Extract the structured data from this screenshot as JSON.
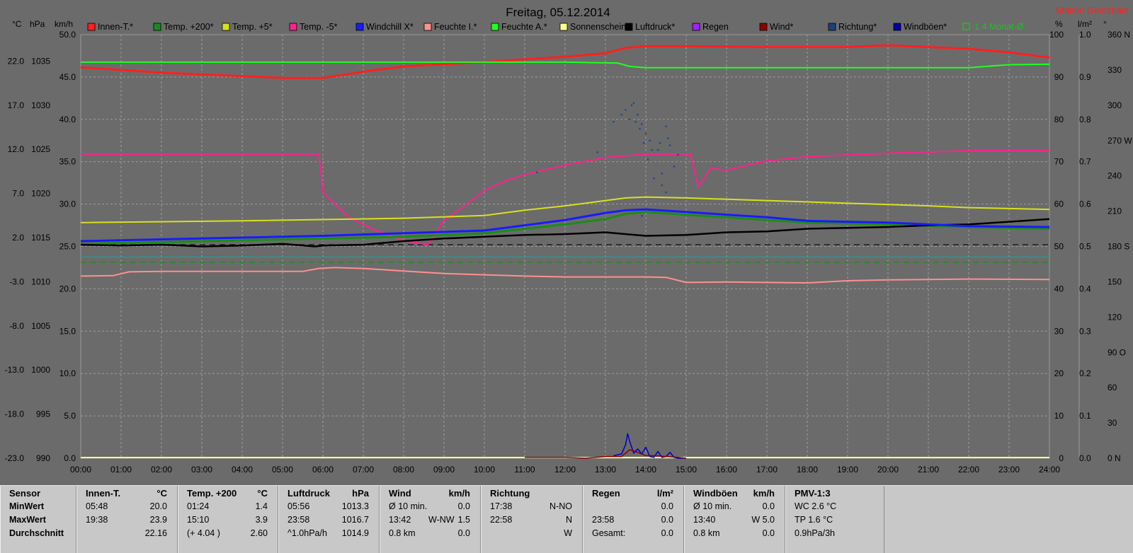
{
  "chart_data": {
    "type": "line",
    "title": "Freitag, 05.12.2014",
    "station": "Station Göritzhain",
    "axis_units": {
      "c": "°C",
      "hpa": "hPa",
      "kmh": "km/h",
      "pct": "%",
      "lm2": "l/m²",
      "deg": "°"
    },
    "x_ticks": [
      "00:00",
      "01:00",
      "02:00",
      "03:00",
      "04:00",
      "05:00",
      "06:00",
      "07:00",
      "08:00",
      "09:00",
      "10:00",
      "11:00",
      "12:00",
      "13:00",
      "14:00",
      "15:00",
      "16:00",
      "17:00",
      "18:00",
      "19:00",
      "20:00",
      "21:00",
      "22:00",
      "23:00",
      "24:00"
    ],
    "xlim": [
      0,
      24
    ],
    "left_axes": {
      "c": [
        "22.0",
        "17.0",
        "12.0",
        "7.0",
        "2.0",
        "-3.0",
        "-8.0",
        "-13.0",
        "-18.0",
        "-23.0"
      ],
      "hpa": [
        "1035",
        "1030",
        "1025",
        "1020",
        "1015",
        "1010",
        "1005",
        "1000",
        "995",
        "990"
      ],
      "kmh": [
        "50.0",
        "45.0",
        "40.0",
        "35.0",
        "30.0",
        "25.0",
        "20.0",
        "15.0",
        "10.0",
        "5.0",
        "0.0"
      ]
    },
    "right_axes": {
      "pct": [
        "100",
        "90",
        "80",
        "70",
        "60",
        "50",
        "40",
        "30",
        "20",
        "10",
        "0"
      ],
      "lm2": [
        "1.0",
        "0.9",
        "0.8",
        "0.7",
        "0.6",
        "0.5",
        "0.4",
        "0.3",
        "0.2",
        "0.1",
        "0.0"
      ],
      "deg": [
        "360 N",
        "330",
        "300",
        "270 W",
        "240",
        "210",
        "180 S",
        "150",
        "120",
        "90 O",
        "60",
        "30",
        "0 N"
      ]
    },
    "legend": [
      {
        "name": "Innen-T.*",
        "color": "#ff2020"
      },
      {
        "name": "Temp. +200*",
        "color": "#1a8c1a"
      },
      {
        "name": "Temp. +5*",
        "color": "#d8e020"
      },
      {
        "name": "Temp. -5*",
        "color": "#ff2090"
      },
      {
        "name": "Windchill X*",
        "color": "#1a1aff"
      },
      {
        "name": "Feuchte I.*",
        "color": "#ff9090"
      },
      {
        "name": "Feuchte A.*",
        "color": "#20ff20"
      },
      {
        "name": "Sonnenschein",
        "color": "#ffff90"
      },
      {
        "name": "Luftdruck*",
        "color": "#000000"
      },
      {
        "name": "Regen",
        "color": "#a020ff"
      },
      {
        "name": "Wind*",
        "color": "#8c0000"
      },
      {
        "name": "Richtung*",
        "color": "#1a4080"
      },
      {
        "name": "Windböen*",
        "color": "#0000a0"
      },
      {
        "name": "-1.4 Monat-Ø",
        "color": "#20c020"
      }
    ],
    "series": [
      {
        "name": "Innen-T.*",
        "axis": "c",
        "color": "#ff2020",
        "width": 3,
        "x": [
          0,
          2,
          4,
          5,
          6,
          7,
          8,
          10,
          12,
          13,
          13.5,
          14,
          15,
          17,
          19,
          20,
          22,
          23,
          24
        ],
        "y": [
          21.3,
          20.7,
          20.3,
          20.1,
          20.1,
          20.8,
          21.4,
          21.9,
          22.5,
          22.9,
          23.5,
          23.7,
          23.7,
          23.6,
          23.6,
          23.8,
          23.4,
          23.0,
          22.4
        ]
      },
      {
        "name": "Feuchte A.*",
        "axis": "pct",
        "color": "#20ff20",
        "width": 2,
        "x": [
          0,
          6,
          12,
          13.3,
          13.6,
          14,
          18,
          22,
          23,
          24
        ],
        "y": [
          93.5,
          93.5,
          93.5,
          93.3,
          92.5,
          92.2,
          92.2,
          92.2,
          92.9,
          93.0
        ]
      },
      {
        "name": "Temp. -5*",
        "axis": "kmh",
        "color": "#ff2090",
        "width": 2,
        "x": [
          0,
          2,
          4,
          5.5,
          5.9,
          6.0,
          6.6,
          7.2,
          8,
          8.6,
          9.0,
          9.4,
          10,
          10.5,
          11,
          12,
          13,
          14,
          14.5,
          15.1,
          15.3,
          15.6,
          16,
          16.5,
          17,
          18,
          20,
          22,
          24
        ],
        "y": [
          35.9,
          35.9,
          35.9,
          35.9,
          35.9,
          31.4,
          28.6,
          27.1,
          25.7,
          25.2,
          28.1,
          29.4,
          31.6,
          32.7,
          33.5,
          34.6,
          35.5,
          35.9,
          35.9,
          35.9,
          32.0,
          34.2,
          34.0,
          34.6,
          35.1,
          35.6,
          36.0,
          36.3,
          36.3
        ]
      },
      {
        "name": "Temp. +5*",
        "axis": "c",
        "color": "#d8e020",
        "width": 2,
        "x": [
          0,
          4,
          8,
          10,
          11,
          12,
          13,
          13.5,
          14,
          15,
          17,
          19,
          21,
          22,
          24
        ],
        "y": [
          3.7,
          3.9,
          4.2,
          4.5,
          5.1,
          5.6,
          6.2,
          6.5,
          6.6,
          6.5,
          6.2,
          5.9,
          5.6,
          5.4,
          5.2
        ]
      },
      {
        "name": "Temp. +200*",
        "axis": "c",
        "color": "#1a8c1a",
        "width": 3,
        "x": [
          0,
          4,
          8,
          10,
          11,
          12,
          13,
          13.5,
          14,
          15,
          16,
          17,
          18,
          20,
          22,
          24
        ],
        "y": [
          1.3,
          1.7,
          2.1,
          2.5,
          3.0,
          3.5,
          4.1,
          4.7,
          4.9,
          4.6,
          4.3,
          4.0,
          3.7,
          3.5,
          3.2,
          3.0
        ]
      },
      {
        "name": "Luftdruck*",
        "axis": "hpa",
        "color": "#000000",
        "width": 2.5,
        "x": [
          0,
          1,
          2,
          3,
          4,
          5,
          5.8,
          6,
          7,
          8,
          9,
          10,
          11,
          12,
          13,
          14,
          15,
          16,
          17,
          18,
          19,
          20,
          21,
          22,
          23,
          24
        ],
        "y": [
          1014.2,
          1014.1,
          1014.2,
          1014.0,
          1014.1,
          1014.3,
          1014.0,
          1014.1,
          1014.2,
          1014.6,
          1014.9,
          1015.1,
          1015.3,
          1015.4,
          1015.6,
          1015.2,
          1015.3,
          1015.6,
          1015.7,
          1016.0,
          1016.1,
          1016.2,
          1016.4,
          1016.5,
          1016.8,
          1017.1
        ]
      },
      {
        "name": "Windchill X*",
        "axis": "c",
        "color": "#1a1aff",
        "width": 3,
        "x": [
          0,
          2,
          4,
          6,
          8,
          10,
          11,
          12,
          13,
          13.5,
          14,
          15,
          16,
          17,
          18,
          19,
          20,
          21,
          22,
          24
        ],
        "y": [
          1.6,
          1.8,
          2.0,
          2.2,
          2.5,
          2.8,
          3.4,
          4.0,
          4.8,
          5.1,
          5.2,
          4.9,
          4.6,
          4.3,
          3.9,
          3.8,
          3.7,
          3.5,
          3.3,
          3.2
        ]
      },
      {
        "name": "Feuchte I.*",
        "axis": "pct",
        "color": "#ff9090",
        "width": 2,
        "x": [
          0,
          0.8,
          1.2,
          2,
          4,
          5.5,
          5.9,
          6.3,
          7,
          8,
          9,
          10,
          11,
          12,
          13,
          14,
          14.5,
          15,
          16,
          17,
          18,
          19,
          20,
          22,
          24
        ],
        "y": [
          43.0,
          43.1,
          44.0,
          44.1,
          44.1,
          44.1,
          44.8,
          45.0,
          44.8,
          44.2,
          43.6,
          43.3,
          43.0,
          42.8,
          42.8,
          42.8,
          42.7,
          41.5,
          41.6,
          41.5,
          41.4,
          41.9,
          42.1,
          42.3,
          42.2
        ]
      },
      {
        "name": "Windböen*",
        "axis": "kmh",
        "color": "#0000c8",
        "width": 1.5,
        "x": [
          13.2,
          13.4,
          13.5,
          13.55,
          13.6,
          13.7,
          13.8,
          13.9,
          14.0,
          14.1,
          14.2,
          14.3,
          14.4,
          14.5,
          14.6,
          14.7,
          14.8,
          15.0
        ],
        "y": [
          0.3,
          0.5,
          1.6,
          2.9,
          2.0,
          0.6,
          1.1,
          0.5,
          1.3,
          0.2,
          0.1,
          0.8,
          0.1,
          0.2,
          0.7,
          0.1,
          0.0,
          0.0
        ]
      },
      {
        "name": "Wind*",
        "axis": "kmh",
        "color": "#8c0000",
        "width": 1.5,
        "x": [
          11.0,
          12.0,
          12.5,
          13.0,
          13.4,
          13.6,
          13.8,
          14.0,
          14.2,
          14.5,
          14.8,
          15.0
        ],
        "y": [
          0.1,
          0.1,
          0.0,
          0.2,
          0.2,
          1.0,
          0.7,
          0.3,
          0.3,
          0.2,
          0.1,
          0.0
        ]
      }
    ],
    "reference_lines": [
      {
        "axis": "c",
        "y": 1.2,
        "color": "#111111",
        "style": "dashed"
      },
      {
        "axis": "c",
        "y": -0.8,
        "color": "#1a8c1a",
        "style": "dashed"
      }
    ],
    "teal_line": {
      "axis": "pct",
      "y": 47.5,
      "color": "#00b0a0"
    },
    "direction_points": {
      "axis": "deg",
      "color": "#1a4a90",
      "x": [
        11.3,
        12.8,
        13.2,
        13.4,
        13.5,
        13.6,
        13.65,
        13.7,
        13.75,
        13.8,
        13.85,
        13.9,
        13.95,
        14.0,
        14.05,
        14.1,
        14.15,
        14.2,
        14.3,
        14.35,
        14.4,
        14.5,
        14.55,
        14.6,
        14.7,
        14.8,
        14.5,
        14.4,
        13.9
      ],
      "y": [
        243,
        260,
        286,
        292,
        296,
        288,
        300,
        302,
        286,
        292,
        280,
        284,
        268,
        276,
        254,
        270,
        262,
        238,
        262,
        268,
        242,
        282,
        272,
        266,
        248,
        258,
        226,
        232,
        206
      ]
    }
  },
  "panel": {
    "columns": [
      {
        "title": "Sensor",
        "unit": "",
        "rows": [
          {
            "a": "MinWert",
            "m": "",
            "b": ""
          },
          {
            "a": "MaxWert",
            "m": "",
            "b": ""
          },
          {
            "a": "Durchschnitt",
            "m": "",
            "b": ""
          }
        ]
      },
      {
        "title": "Innen-T.",
        "unit": "°C",
        "rows": [
          {
            "a": "05:48",
            "m": "",
            "b": "20.0"
          },
          {
            "a": "19:38",
            "m": "",
            "b": "23.9"
          },
          {
            "a": "",
            "m": "",
            "b": "22.16"
          }
        ]
      },
      {
        "title": "Temp. +200",
        "unit": "°C",
        "rows": [
          {
            "a": "01:24",
            "m": "",
            "b": "1.4"
          },
          {
            "a": "15:10",
            "m": "",
            "b": "3.9"
          },
          {
            "a": "(+ 4.04 )",
            "m": "",
            "b": "2.60"
          }
        ]
      },
      {
        "title": "Luftdruck",
        "unit": "hPa",
        "rows": [
          {
            "a": "05:56",
            "m": "",
            "b": "1013.3"
          },
          {
            "a": "23:58",
            "m": "",
            "b": "1016.7"
          },
          {
            "a": "^1.0hPa/h",
            "m": "",
            "b": "1014.9"
          }
        ]
      },
      {
        "title": "Wind",
        "unit": "km/h",
        "rows": [
          {
            "a": "Ø 10 min.",
            "m": "",
            "b": "0.0"
          },
          {
            "a": "13:42",
            "m": "W-NW",
            "b": "1.5"
          },
          {
            "a": "0.8 km",
            "m": "",
            "b": "0.0"
          }
        ]
      },
      {
        "title": "Richtung",
        "unit": "",
        "rows": [
          {
            "a": "17:38",
            "m": "",
            "b": "N-NO"
          },
          {
            "a": "22:58",
            "m": "",
            "b": "N"
          },
          {
            "a": "",
            "m": "",
            "b": "W"
          }
        ]
      },
      {
        "title": "Regen",
        "unit": "l/m²",
        "rows": [
          {
            "a": "",
            "m": "",
            "b": "0.0"
          },
          {
            "a": "23:58",
            "m": "",
            "b": "0.0"
          },
          {
            "a": "Gesamt:",
            "m": "",
            "b": "0.0"
          }
        ]
      },
      {
        "title": "Windböen",
        "unit": "km/h",
        "rows": [
          {
            "a": "Ø 10 min.",
            "m": "",
            "b": "0.0"
          },
          {
            "a": "13:40",
            "m": "",
            "b": "W 5.0"
          },
          {
            "a": "0.8 km",
            "m": "",
            "b": "0.0"
          }
        ]
      },
      {
        "title": "PMV-1:3",
        "unit": "",
        "rows": [
          {
            "a": "WC 2.6 °C",
            "m": "",
            "b": ""
          },
          {
            "a": "TP 1.6 °C",
            "m": "",
            "b": ""
          },
          {
            "a": "0.9hPa/3h",
            "m": "",
            "b": ""
          }
        ]
      }
    ]
  }
}
